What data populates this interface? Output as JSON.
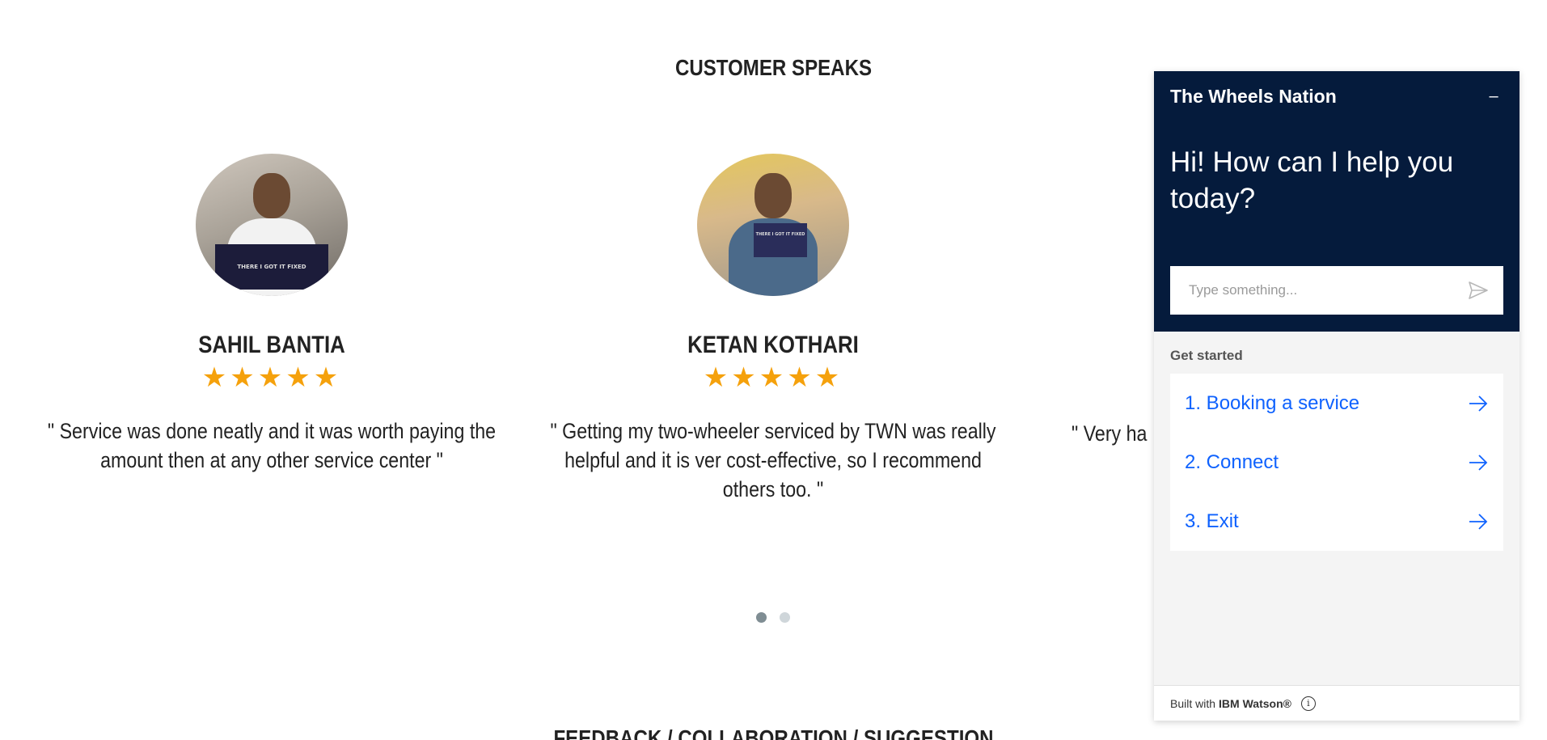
{
  "section": {
    "title": "CUSTOMER SPEAKS"
  },
  "testimonials": [
    {
      "name": "SAHIL BANTIA",
      "stars": "★★★★★",
      "quote": "\" Service was done neatly and it was worth paying the amount then at any other service center \"",
      "sign_text": "THERE I GOT IT FIXED"
    },
    {
      "name": "KETAN KOTHARI",
      "stars": "★★★★★",
      "quote": "\" Getting my two-wheeler serviced by TWN was really helpful and it is ver cost-effective, so I recommend others too. \"",
      "sign_text": "THERE I GOT IT FIXED"
    },
    {
      "quote": "\" Very ha"
    }
  ],
  "carousel": {
    "active_index": 0,
    "count": 2
  },
  "bottom_section": {
    "title": "FEEDBACK / COLLABORATION / SUGGESTION"
  },
  "chat": {
    "title": "The Wheels Nation",
    "minimize_label": "–",
    "greeting": "Hi! How can I help you today?",
    "input_placeholder": "Type something...",
    "get_started_label": "Get started",
    "options": [
      {
        "label": "1. Booking a service"
      },
      {
        "label": "2. Connect"
      },
      {
        "label": "3. Exit"
      }
    ],
    "footer_prefix": "Built with",
    "footer_brand": "IBM Watson®",
    "info_label": "i",
    "colors": {
      "header_bg": "#051b3c",
      "link": "#0f62fe"
    }
  },
  "colors": {
    "star": "#f5a10c",
    "dot_active": "#7f8d93",
    "dot_inactive": "#cfd6da"
  }
}
